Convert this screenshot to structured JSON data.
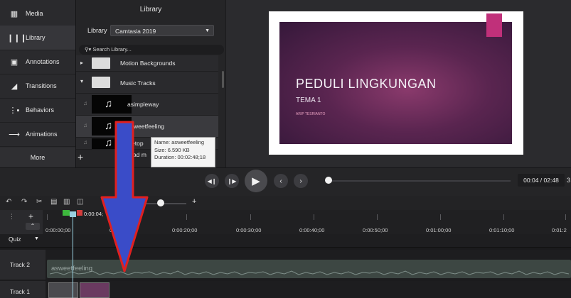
{
  "sidebar": {
    "items": [
      {
        "label": "Media",
        "icon": "film-icon"
      },
      {
        "label": "Library",
        "icon": "books-icon"
      },
      {
        "label": "Annotations",
        "icon": "annotation-icon"
      },
      {
        "label": "Transitions",
        "icon": "transition-icon"
      },
      {
        "label": "Behaviors",
        "icon": "behavior-icon"
      },
      {
        "label": "Animations",
        "icon": "animation-icon"
      }
    ],
    "more_label": "More"
  },
  "library": {
    "title": "Library",
    "select_label": "Library",
    "selected_library": "Camtasia 2019",
    "search_placeholder": "Search Library...",
    "folders": [
      {
        "name": "Motion Backgrounds"
      },
      {
        "name": "Music Tracks"
      }
    ],
    "tracks": [
      {
        "name": "asimpleway"
      },
      {
        "name": "asweetfeeling"
      },
      {
        "name": "etop"
      },
      {
        "name": "ad m"
      }
    ]
  },
  "tooltip": {
    "name": "Name: asweetfeeling",
    "size": "Size: 6.590 KB",
    "duration": "Duration: 00:02:48;18"
  },
  "slide": {
    "title": "PEDULI LINGKUNGAN",
    "subtitle": "TEMA 1",
    "author": "ARIP TESRIANTO"
  },
  "playback": {
    "time": "00:04 / 02:48",
    "time_extra": "3"
  },
  "timeline": {
    "playhead_time": "0:00:04;",
    "ruler_labels": [
      "0:00:00;00",
      "0",
      "0:00:20;00",
      "0:00:30;00",
      "0:00:40;00",
      "0:00:50;00",
      "0:01:00;00",
      "0:01:10;00",
      "0:01:2"
    ],
    "quiz_label": "Quiz",
    "tracks": [
      {
        "label": "Track 2",
        "clip_label": "asweetfeeling"
      },
      {
        "label": "Track 1"
      }
    ]
  }
}
